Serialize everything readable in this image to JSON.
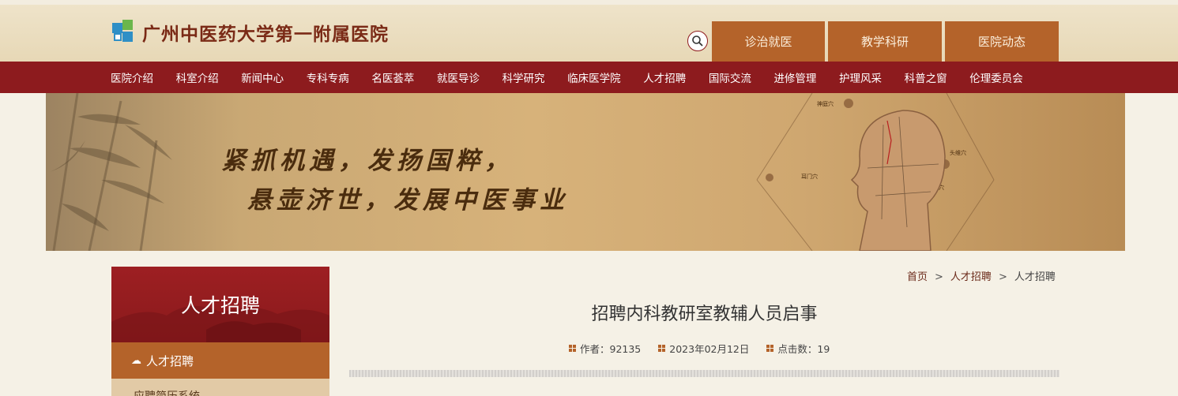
{
  "header": {
    "logo_text": "广州中医药大学第一附属医院",
    "search_icon": "search-icon",
    "top_tabs": [
      {
        "label": "诊治就医"
      },
      {
        "label": "教学科研"
      },
      {
        "label": "医院动态"
      }
    ]
  },
  "nav": {
    "items": [
      {
        "label": "医院介绍"
      },
      {
        "label": "科室介绍"
      },
      {
        "label": "新闻中心"
      },
      {
        "label": "专科专病"
      },
      {
        "label": "名医荟萃"
      },
      {
        "label": "就医导诊"
      },
      {
        "label": "科学研究"
      },
      {
        "label": "临床医学院"
      },
      {
        "label": "人才招聘"
      },
      {
        "label": "国际交流"
      },
      {
        "label": "进修管理"
      },
      {
        "label": "护理风采"
      },
      {
        "label": "科普之窗"
      },
      {
        "label": "伦理委员会"
      }
    ]
  },
  "banner": {
    "line1": "紧抓机遇，发扬国粹，",
    "line2": "悬壶济世，发展中医事业",
    "labels": [
      "神庭穴",
      "头维穴",
      "耳门穴",
      "风池穴"
    ]
  },
  "sidebar": {
    "title": "人才招聘",
    "items": [
      {
        "label": "人才招聘"
      },
      {
        "label": "应聘简历系统"
      }
    ]
  },
  "breadcrumb": {
    "items": [
      "首页",
      "人才招聘",
      "人才招聘"
    ],
    "separator": ">"
  },
  "article": {
    "title": "招聘内科教研室教辅人员启事",
    "author": "作者：92135",
    "date": "2023年02月12日",
    "views": "点击数：19"
  },
  "colors": {
    "nav_bg": "#8d1b1e",
    "tab_bg": "#b4632a",
    "logo_text": "#7a2a16"
  }
}
